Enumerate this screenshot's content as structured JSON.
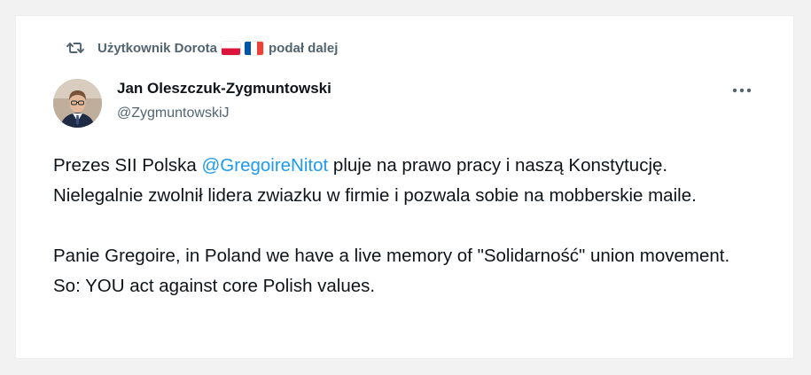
{
  "retweet": {
    "user_label": "Użytkownik Dorota",
    "suffix": "podał dalej",
    "flags": [
      "flag-poland-icon",
      "flag-france-icon"
    ]
  },
  "author": {
    "name": "Jan Oleszczuk-Zygmuntowski",
    "handle": "@ZygmuntowskiJ"
  },
  "tweet": {
    "p1_before": "Prezes SII Polska ",
    "p1_mention": "@GregoireNitot",
    "p1_after": " pluje na prawo pracy i naszą Konstytucję. Nielegalnie zwolnił lidera zwiazku w firmie i pozwala sobie na mobberskie maile.",
    "p2": "Panie Gregoire, in Poland we have a live memory of \"Solidarność\" union movement. So: YOU act against core Polish values."
  },
  "colors": {
    "muted": "#536471",
    "text": "#0f1419",
    "link": "#1d9bf0",
    "background": "#f2f2f3"
  }
}
